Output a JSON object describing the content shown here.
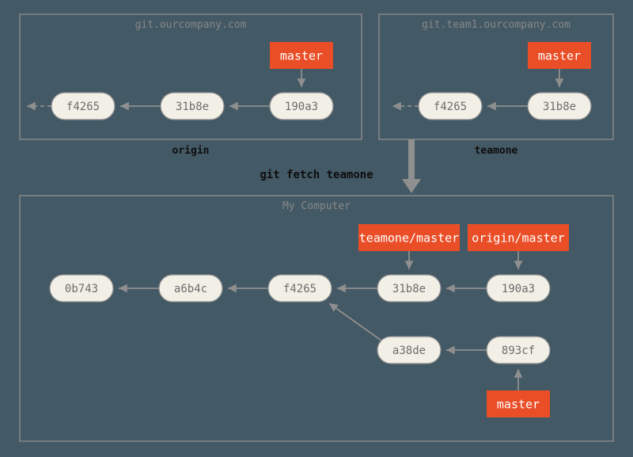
{
  "origin": {
    "title": "git.ourcompany.com",
    "label": "origin",
    "ref": "master",
    "commits": [
      "f4265",
      "31b8e",
      "190a3"
    ]
  },
  "teamone": {
    "title": "git.team1.ourcompany.com",
    "label": "teamone",
    "ref": "master",
    "commits": [
      "f4265",
      "31b8e"
    ]
  },
  "fetch_command": "git fetch teamone",
  "local": {
    "title": "My Computer",
    "refs": {
      "teamone_master": "teamone/master",
      "origin_master": "origin/master",
      "master": "master"
    },
    "commits_top": [
      "0b743",
      "a6b4c",
      "f4265",
      "31b8e",
      "190a3"
    ],
    "commits_bottom": [
      "a38de",
      "893cf"
    ]
  },
  "colors": {
    "background": "#435965",
    "ref": "#ea4e27",
    "pill": "#f1efe6",
    "border": "#888"
  }
}
